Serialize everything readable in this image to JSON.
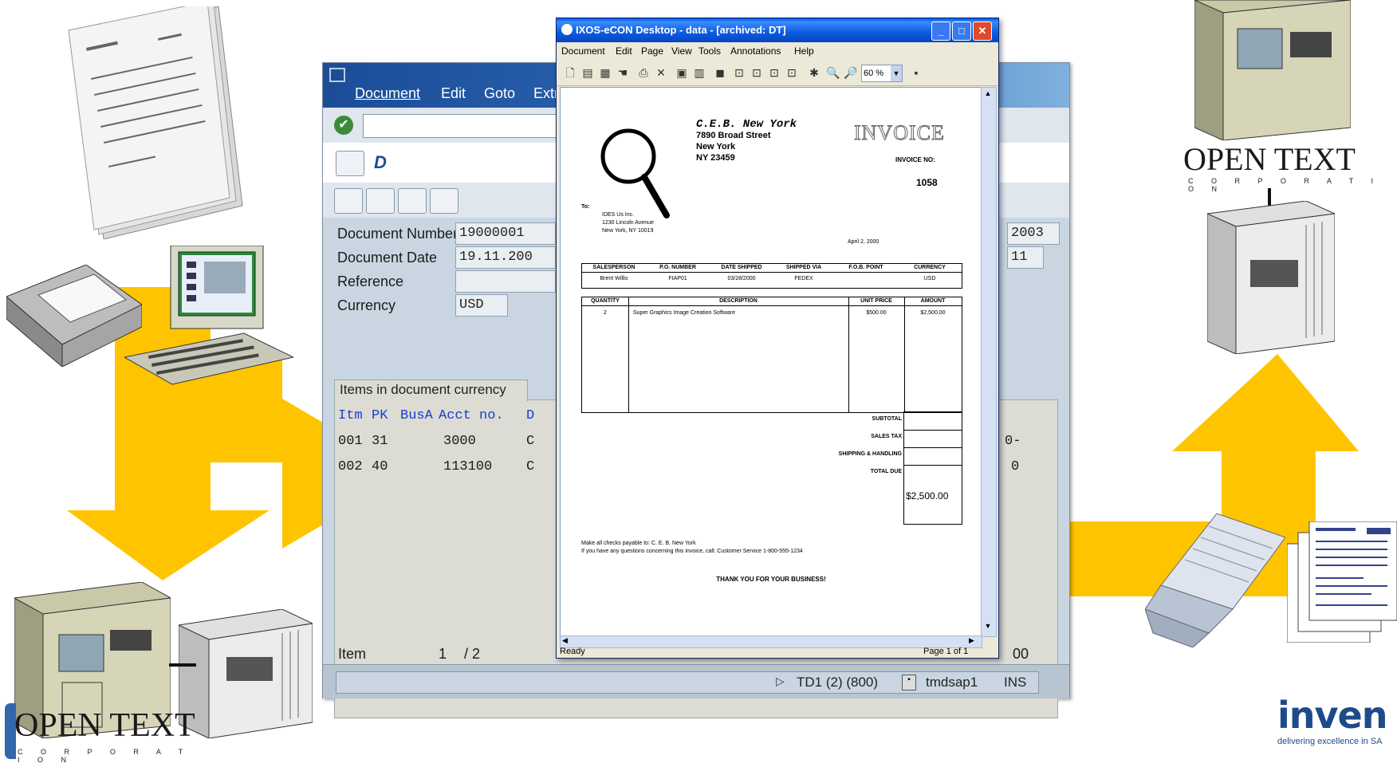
{
  "sap": {
    "menu": [
      "Document",
      "Edit",
      "Goto",
      "Extr"
    ],
    "title_fragment": "D",
    "fields": {
      "document_number_label": "Document Number",
      "document_number_value": "19000001",
      "document_date_label": "Document Date",
      "document_date_value": "19.11.200",
      "reference_label": "Reference",
      "currency_label": "Currency",
      "currency_value": "USD",
      "right_value_1": "2003",
      "right_value_2": "11"
    },
    "items_tab": "Items in document currency",
    "items_header": [
      "Itm",
      "PK",
      "BusA",
      "Acct no.",
      "D"
    ],
    "items": [
      {
        "itm": "001",
        "pk": "31",
        "acct": "3000",
        "d": "C",
        "tail": "0-"
      },
      {
        "itm": "002",
        "pk": "40",
        "acct": "113100",
        "d": "C",
        "tail": "0"
      }
    ],
    "item_label": "Item",
    "item_current": "1",
    "item_total": "/ 2",
    "item_tail": "00",
    "status": {
      "system": "TD1 (2) (800)",
      "server": "tmdsap1",
      "mode": "INS"
    }
  },
  "viewer": {
    "title": "IXOS-eCON Desktop - data - [archived: DT]",
    "menu": [
      "Document",
      "Edit",
      "Page",
      "View",
      "Tools",
      "Annotations",
      "Help"
    ],
    "zoom": "60 %",
    "status_left": "Ready",
    "status_right": "Page 1 of 1",
    "invoice": {
      "company": "C.E.B. New York",
      "street": "7890 Broad Street",
      "city": "New York",
      "zip": "NY 23459",
      "heading": "INVOICE",
      "invoice_no_label": "INVOICE NO:",
      "invoice_no": "1058",
      "to_label": "To:",
      "to_lines": [
        "IDES Us Inc.",
        "1230 Lincoln Avenue",
        "New York, NY 10019"
      ],
      "date": "April 2, 2000",
      "ship_headers": [
        "SALESPERSON",
        "P.O. NUMBER",
        "DATE SHIPPED",
        "SHIPPED VIA",
        "F.O.B. POINT",
        "CURRENCY"
      ],
      "ship_values": [
        "Brent Willis",
        "FIAP01",
        "03/28/2000",
        "FEDEX",
        "",
        "USD"
      ],
      "item_headers": [
        "QUANTITY",
        "DESCRIPTION",
        "UNIT PRICE",
        "AMOUNT"
      ],
      "item_row": [
        "2",
        "Super Graphics Image Creation Software",
        "$500.00",
        "$2,500.00"
      ],
      "totals_labels": [
        "SUBTOTAL",
        "SALES TAX",
        "SHIPPING & HANDLING",
        "TOTAL DUE"
      ],
      "total_due": "$2,500.00",
      "footer_1": "Make all checks payable to: C. E. B. New York",
      "footer_2": "If you have any questions concerning this invoice, call: Customer Service 1-800-555-1234",
      "thanks": "THANK YOU FOR YOUR BUSINESS!"
    }
  },
  "brand": {
    "opentext": "OPEN TEXT",
    "corporation": "C O R P O R A T I O N",
    "inven": "inven",
    "tagline": "delivering excellence in SA"
  },
  "colors": {
    "arrow": "#ffc400",
    "sap_blue": "#1b4d97",
    "xp_blue": "#0058ee"
  },
  "icons": [
    "paper-stack-icon",
    "scanner-icon",
    "workstation-icon",
    "server-icon",
    "jukebox-icon",
    "magnifier-icon",
    "print-list-icon",
    "document-stack-icon"
  ]
}
